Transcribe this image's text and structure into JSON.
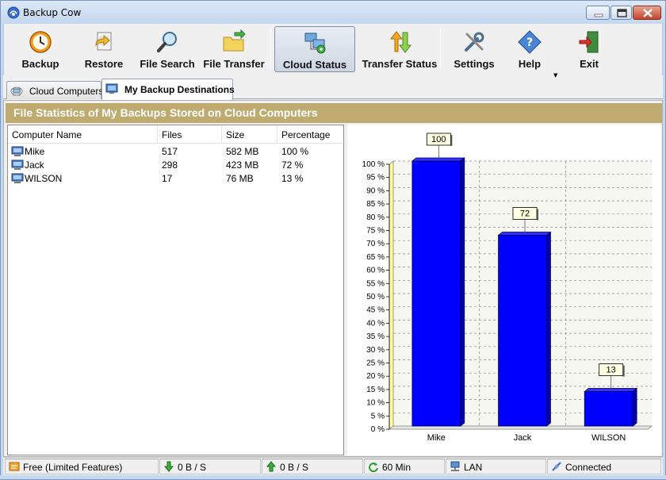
{
  "window": {
    "title": "Backup Cow"
  },
  "toolbar": {
    "buttons": [
      {
        "label": "Backup",
        "icon": "clock-icon"
      },
      {
        "label": "Restore",
        "icon": "restore-icon"
      },
      {
        "label": "File Search",
        "icon": "magnifier-icon"
      },
      {
        "label": "File Transfer",
        "icon": "folder-transfer-icon"
      },
      {
        "label": "Cloud Status",
        "icon": "network-computers-icon",
        "active": true
      },
      {
        "label": "Transfer Status",
        "icon": "transfer-arrows-icon"
      },
      {
        "label": "Settings",
        "icon": "tools-icon"
      },
      {
        "label": "Help",
        "icon": "help-diamond-icon"
      },
      {
        "label": "Exit",
        "icon": "exit-door-icon"
      }
    ]
  },
  "tabs": [
    {
      "label": "Cloud Computers",
      "icon": "cloud-computers-icon",
      "active": false
    },
    {
      "label": "My Backup Destinations",
      "icon": "monitor-icon",
      "active": true
    }
  ],
  "panel": {
    "header": "File Statistics of My Backups Stored on Cloud Computers"
  },
  "table": {
    "columns": [
      "Computer Name",
      "Files",
      "Size",
      "Percentage"
    ],
    "rows": [
      {
        "name": "Mike",
        "files": "517",
        "size": "582 MB",
        "percentage": "100 %"
      },
      {
        "name": "Jack",
        "files": "298",
        "size": "423 MB",
        "percentage": "72 %"
      },
      {
        "name": "WILSON",
        "files": "17",
        "size": "76 MB",
        "percentage": "13 %"
      }
    ]
  },
  "chart_data": {
    "type": "bar",
    "categories": [
      "Mike",
      "Jack",
      "WILSON"
    ],
    "values": [
      100,
      72,
      13
    ],
    "data_labels": [
      "100",
      "72",
      "13"
    ],
    "ylim": [
      0,
      100
    ],
    "yticks": [
      "0 %",
      "5 %",
      "10 %",
      "15 %",
      "20 %",
      "25 %",
      "30 %",
      "35 %",
      "40 %",
      "45 %",
      "50 %",
      "55 %",
      "60 %",
      "65 %",
      "70 %",
      "75 %",
      "80 %",
      "85 %",
      "90 %",
      "95 %",
      "100 %"
    ],
    "grid": true,
    "bar_color": "#0000ff",
    "title": "",
    "xlabel": "",
    "ylabel": ""
  },
  "status": {
    "cells": [
      {
        "text": "Free (Limited Features)",
        "icon": "license-icon"
      },
      {
        "text": "0 B / S",
        "icon": "download-arrow-icon"
      },
      {
        "text": "0 B / S",
        "icon": "upload-arrow-icon"
      },
      {
        "text": "60 Min",
        "icon": "refresh-icon"
      },
      {
        "text": "LAN",
        "icon": "lan-icon"
      },
      {
        "text": "Connected",
        "icon": "connected-icon"
      }
    ]
  },
  "colors": {
    "panel_header": "#bfab6f",
    "bar": "#0000ff",
    "titlebar": "#c4d8f0"
  }
}
